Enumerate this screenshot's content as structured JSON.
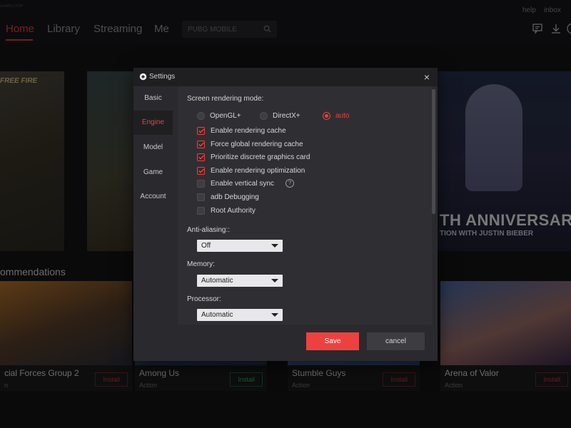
{
  "topbar": {
    "logo_text": "GAMELOOP",
    "links": {
      "help": "help",
      "inbox": "inbox"
    },
    "nav": [
      {
        "label": "Home",
        "active": true
      },
      {
        "label": "Library"
      },
      {
        "label": "Streaming"
      },
      {
        "label": "Me"
      }
    ],
    "search": {
      "placeholder": "PUBG MOBILE"
    },
    "icons": [
      "message-icon",
      "download-icon"
    ]
  },
  "banners": {
    "left_text": "FREE FIRE",
    "right_title": "TH ANNIVERSARY",
    "right_subtitle": "TION WITH JUSTIN BIEBER"
  },
  "recommendations": {
    "title": "ommendations",
    "cards": [
      {
        "title": "cial Forces Group 2",
        "genre": "n",
        "install": "Install"
      },
      {
        "title": "Among Us",
        "genre": "Action",
        "install": "Install"
      },
      {
        "title": "Stumble Guys",
        "genre": "Action",
        "install": "Install"
      },
      {
        "title": "Arena of Valor",
        "genre": "Action",
        "install": "Install"
      }
    ]
  },
  "dialog": {
    "title": "Settings",
    "close": "×",
    "tabs": [
      {
        "label": "Basic"
      },
      {
        "label": "Engine",
        "active": true
      },
      {
        "label": "Model"
      },
      {
        "label": "Game"
      },
      {
        "label": "Account"
      }
    ],
    "rendering_mode": {
      "label": "Screen rendering mode:",
      "options": [
        {
          "label": "OpenGL+",
          "checked": false
        },
        {
          "label": "DirectX+",
          "checked": false
        },
        {
          "label": "auto",
          "checked": true
        }
      ]
    },
    "checkboxes": [
      {
        "label": "Enable rendering cache",
        "checked": true
      },
      {
        "label": "Force global rendering cache",
        "checked": true
      },
      {
        "label": "Prioritize discrete graphics card",
        "checked": true
      },
      {
        "label": "Enable rendering optimization",
        "checked": true
      },
      {
        "label": "Enable vertical sync",
        "checked": false,
        "help": "?"
      },
      {
        "label": "adb Debugging",
        "checked": false
      },
      {
        "label": "Root Authority",
        "checked": false
      }
    ],
    "anti_aliasing": {
      "label": "Anti-aliasing::",
      "value": "Off"
    },
    "memory": {
      "label": "Memory:",
      "value": "Automatic"
    },
    "processor": {
      "label": "Processor:",
      "value": "Automatic"
    },
    "buttons": {
      "save": "Save",
      "cancel": "cancel"
    }
  },
  "colors": {
    "accent": "#e8413f",
    "dialog_bg": "#2a2a2e",
    "content_bg": "#2f2f33",
    "app_bg": "#141416"
  }
}
